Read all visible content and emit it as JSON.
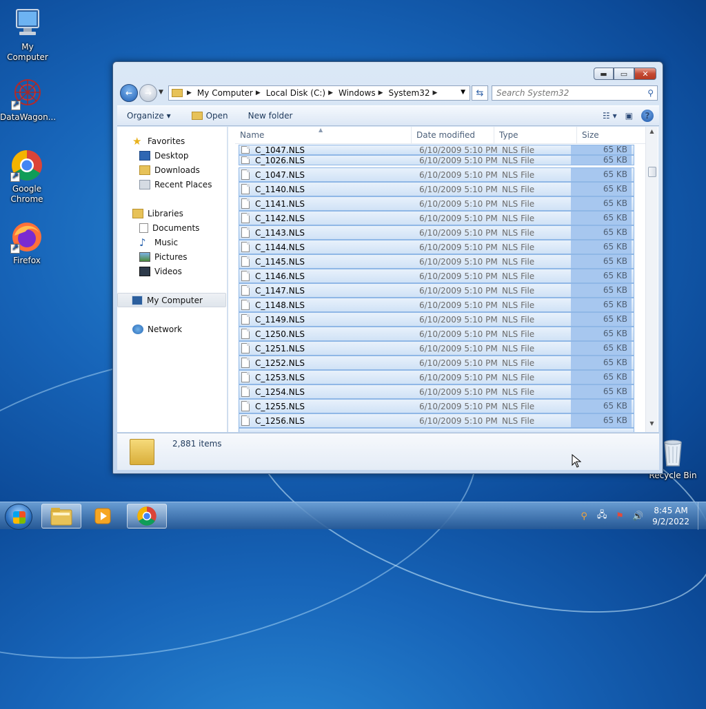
{
  "desktop": {
    "icons": [
      {
        "label": "My Computer"
      },
      {
        "label": "DataWagon..."
      },
      {
        "label": "Google Chrome"
      },
      {
        "label": "Firefox"
      },
      {
        "label": "Recycle Bin"
      }
    ]
  },
  "window": {
    "controls": {
      "minimize": "▬",
      "maximize": "▭",
      "close": "✕"
    },
    "address": {
      "crumbs": [
        "My Computer",
        "Local Disk (C:)",
        "Windows",
        "System32"
      ],
      "separator": "▶"
    },
    "search": {
      "placeholder": "Search System32"
    },
    "toolbar": {
      "organize": "Organize ▾",
      "open": "Open",
      "new_folder": "New folder"
    },
    "nav_pane": {
      "favorites": "Favorites",
      "desktop": "Desktop",
      "downloads": "Downloads",
      "recent_places": "Recent Places",
      "libraries": "Libraries",
      "documents": "Documents",
      "music": "Music",
      "pictures": "Pictures",
      "videos": "Videos",
      "my_computer": "My Computer",
      "network": "Network"
    },
    "columns": {
      "name": "Name",
      "date": "Date modified",
      "type": "Type",
      "size": "Size"
    },
    "files": [
      {
        "name": "C_1047.NLS",
        "date": "6/10/2009 5:10 PM",
        "type": "NLS File",
        "size": "65 KB"
      },
      {
        "name": "C_1026.NLS",
        "date": "6/10/2009 5:10 PM",
        "type": "NLS File",
        "size": "65 KB"
      },
      {
        "name": "C_1047.NLS",
        "date": "6/10/2009 5:10 PM",
        "type": "NLS File",
        "size": "65 KB"
      },
      {
        "name": "C_1140.NLS",
        "date": "6/10/2009 5:10 PM",
        "type": "NLS File",
        "size": "65 KB"
      },
      {
        "name": "C_1141.NLS",
        "date": "6/10/2009 5:10 PM",
        "type": "NLS File",
        "size": "65 KB"
      },
      {
        "name": "C_1142.NLS",
        "date": "6/10/2009 5:10 PM",
        "type": "NLS File",
        "size": "65 KB"
      },
      {
        "name": "C_1143.NLS",
        "date": "6/10/2009 5:10 PM",
        "type": "NLS File",
        "size": "65 KB"
      },
      {
        "name": "C_1144.NLS",
        "date": "6/10/2009 5:10 PM",
        "type": "NLS File",
        "size": "65 KB"
      },
      {
        "name": "C_1145.NLS",
        "date": "6/10/2009 5:10 PM",
        "type": "NLS File",
        "size": "65 KB"
      },
      {
        "name": "C_1146.NLS",
        "date": "6/10/2009 5:10 PM",
        "type": "NLS File",
        "size": "65 KB"
      },
      {
        "name": "C_1147.NLS",
        "date": "6/10/2009 5:10 PM",
        "type": "NLS File",
        "size": "65 KB"
      },
      {
        "name": "C_1148.NLS",
        "date": "6/10/2009 5:10 PM",
        "type": "NLS File",
        "size": "65 KB"
      },
      {
        "name": "C_1149.NLS",
        "date": "6/10/2009 5:10 PM",
        "type": "NLS File",
        "size": "65 KB"
      },
      {
        "name": "C_1250.NLS",
        "date": "6/10/2009 5:10 PM",
        "type": "NLS File",
        "size": "65 KB"
      },
      {
        "name": "C_1251.NLS",
        "date": "6/10/2009 5:10 PM",
        "type": "NLS File",
        "size": "65 KB"
      },
      {
        "name": "C_1252.NLS",
        "date": "6/10/2009 5:10 PM",
        "type": "NLS File",
        "size": "65 KB"
      },
      {
        "name": "C_1253.NLS",
        "date": "6/10/2009 5:10 PM",
        "type": "NLS File",
        "size": "65 KB"
      },
      {
        "name": "C_1254.NLS",
        "date": "6/10/2009 5:10 PM",
        "type": "NLS File",
        "size": "65 KB"
      },
      {
        "name": "C_1255.NLS",
        "date": "6/10/2009 5:10 PM",
        "type": "NLS File",
        "size": "65 KB"
      },
      {
        "name": "C_1256.NLS",
        "date": "6/10/2009 5:10 PM",
        "type": "NLS File",
        "size": "65 KB"
      }
    ],
    "status": {
      "item_count": "2,881 items"
    }
  },
  "taskbar": {
    "clock": {
      "time": "8:45 AM",
      "date": "9/2/2022"
    }
  },
  "colors": {
    "selection_bg": "#d0e2f6",
    "selection_border": "#8fb7e6",
    "size_highlight": "#a7c7ef",
    "close_red": "#c44a34"
  }
}
